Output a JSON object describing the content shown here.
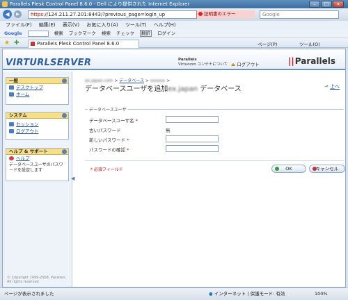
{
  "window": {
    "title": "Parallels Plesk Control Panel 8.6.0 - Dell により提供された Internet Explorer"
  },
  "address": {
    "url_scheme": "https",
    "url_rest": "://124.211.27.201:8443/?previous_page=login_up",
    "cert_error": "証明書のエラー",
    "search_placeholder": "Google"
  },
  "menu": [
    "ファイル(F)",
    "編集(E)",
    "表示(V)",
    "お気に入り(A)",
    "ツール(T)",
    "ヘルプ(H)"
  ],
  "google_toolbar": {
    "label": "Google",
    "items": [
      "検索",
      "ブックマーク",
      "検索",
      "チェック",
      "翻訳",
      "ログイン"
    ]
  },
  "tab": {
    "label": "Parallels Plesk Control Panel 8.6.0",
    "tools": [
      "ページ(P)",
      "ツール(O)"
    ]
  },
  "header": {
    "logo": "VIRTURLSERVER",
    "product": "Parallels",
    "virtuozzo": "Virtuozzo コンテナについて",
    "logout": "ログアウト",
    "brand": "Parallels"
  },
  "sidebar": {
    "general": {
      "title": "一般",
      "items": [
        "デスクトップ",
        "ホーム"
      ]
    },
    "system": {
      "title": "システム",
      "items": [
        "セッション",
        "ログアウト"
      ]
    },
    "help": {
      "title": "ヘルプ & サポート",
      "link": "ヘルプ",
      "text": "データベースユーザのパスワードを設定します"
    },
    "copyright": "© Copyright 1999-2008, Parallels\nAll rights reserved"
  },
  "main": {
    "breadcrumb": {
      "part1": "ex.japan.com",
      "sep1": ">",
      "part2": "データベース",
      "sep2": ">",
      "part3": "xxxxxx",
      "sep3": ">"
    },
    "title_prefix": "データベースユーザを追加",
    "title_blur": "ex.japan",
    "title_suffix": " データベース",
    "up": "上へ",
    "legend": "データベースユーザ",
    "fields": [
      {
        "label": "データベースユーザ名",
        "required": "*"
      },
      {
        "label": "古いパスワード",
        "value": "無"
      },
      {
        "label": "新しいパスワード",
        "required": "*"
      },
      {
        "label": "パスワードの確認",
        "required": "*"
      }
    ],
    "required_note": "* 必須フィールド",
    "ok": "OK",
    "cancel": "キャンセル"
  },
  "status": {
    "left": "ページが表示されました",
    "zone": "インターネット | 保護モード: 有効",
    "zoom": "100%"
  }
}
